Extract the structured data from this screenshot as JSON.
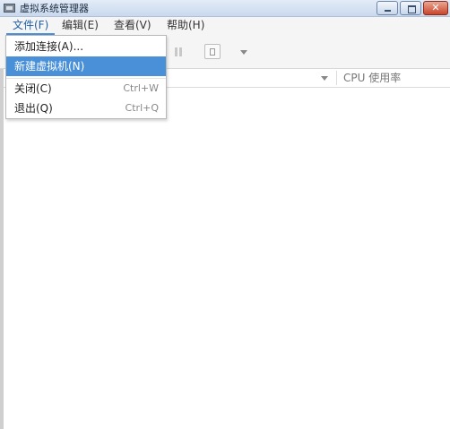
{
  "window": {
    "title": "虚拟系统管理器"
  },
  "menubar": {
    "items": [
      {
        "label": "文件(F)"
      },
      {
        "label": "编辑(E)"
      },
      {
        "label": "查看(V)"
      },
      {
        "label": "帮助(H)"
      }
    ]
  },
  "file_menu": {
    "items": [
      {
        "label": "添加连接(A)...",
        "accel": ""
      },
      {
        "label": "新建虚拟机(N)",
        "accel": ""
      },
      {
        "label": "关闭(C)",
        "accel": "Ctrl+W"
      },
      {
        "label": "退出(Q)",
        "accel": "Ctrl+Q"
      }
    ]
  },
  "list": {
    "columns": {
      "cpu": "CPU 使用率"
    }
  },
  "colors": {
    "accent": "#4a90d9",
    "hover_text": "#ffffff"
  },
  "icons": [
    "app-icon",
    "minimize-icon",
    "maximize-icon",
    "close-icon",
    "pause-icon",
    "stop-icon",
    "dropdown-arrow-icon",
    "sort-arrow-icon"
  ]
}
